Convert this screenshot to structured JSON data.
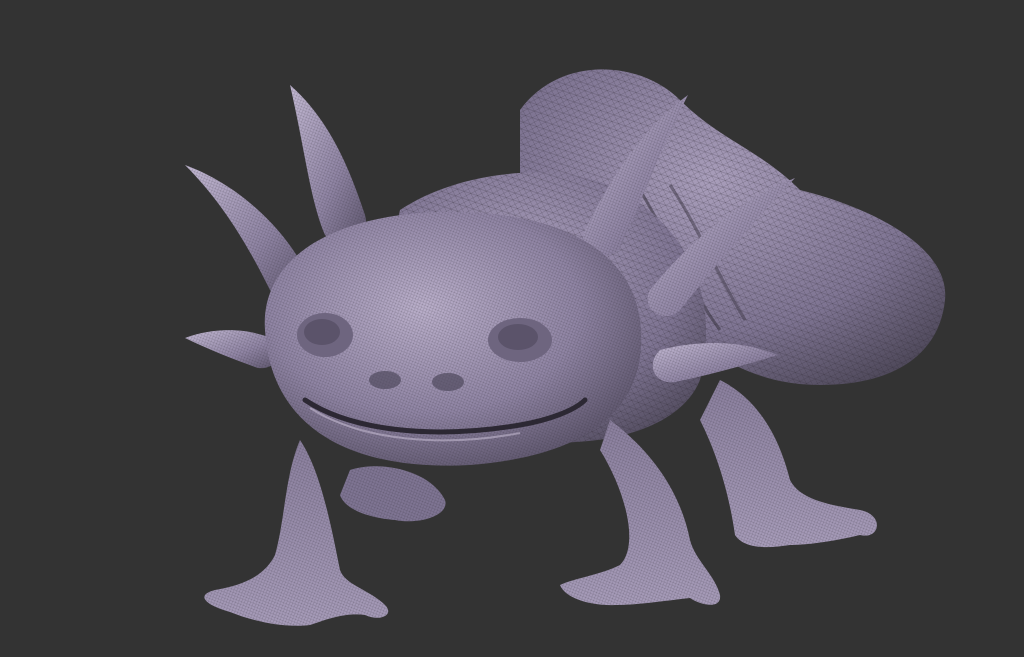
{
  "viewport": {
    "background_color": "#333333",
    "model_subject": "axolotl-sculpt-wireframe",
    "colors": {
      "skin_light": "#b9aec9",
      "skin_mid": "#8f84a3",
      "skin_dark": "#5e566d",
      "skin_shadow": "#3d3846",
      "wire": "#2c2833"
    }
  }
}
